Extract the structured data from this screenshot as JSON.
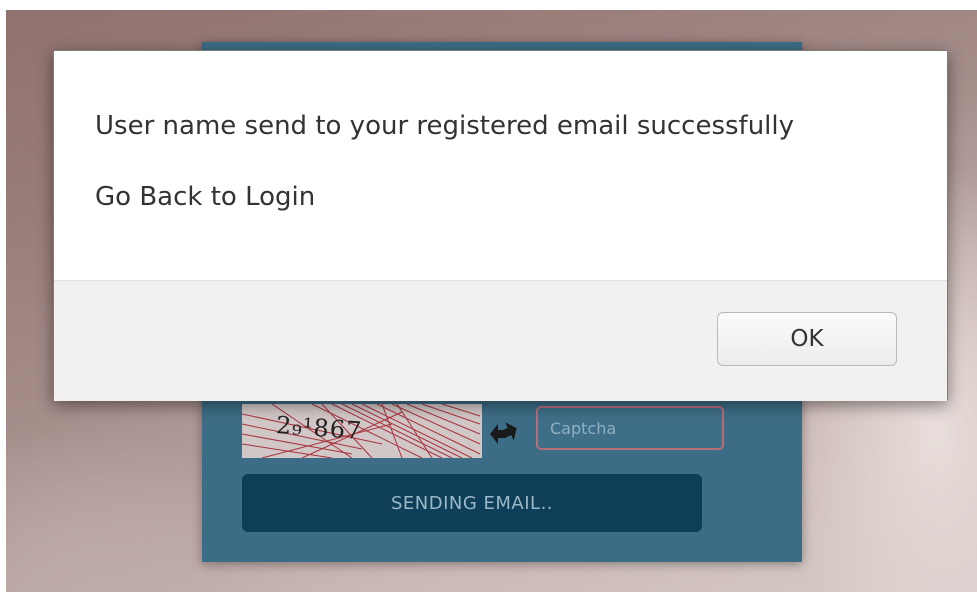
{
  "dialog": {
    "message": "User name send to your registered email successfully",
    "link_text": "Go Back to Login",
    "ok_label": "OK"
  },
  "form": {
    "captcha_code": "2₉¹867",
    "captcha_placeholder": "Captcha",
    "send_label": "SENDING EMAIL.."
  },
  "icons": {
    "refresh": "refresh-icon"
  },
  "colors": {
    "panel": "#3d6d86",
    "send_button": "#0f3f58",
    "captcha_border": "#b76e7a"
  }
}
